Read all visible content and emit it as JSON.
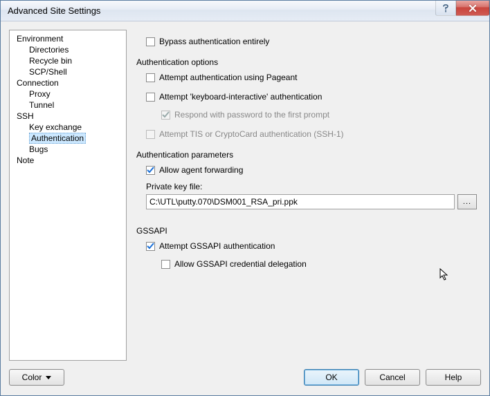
{
  "title": "Advanced Site Settings",
  "tree": {
    "environment": "Environment",
    "directories": "Directories",
    "recycle": "Recycle bin",
    "scp": "SCP/Shell",
    "connection": "Connection",
    "proxy": "Proxy",
    "tunnel": "Tunnel",
    "ssh": "SSH",
    "kex": "Key exchange",
    "auth": "Authentication",
    "bugs": "Bugs",
    "note": "Note"
  },
  "main": {
    "bypass": "Bypass authentication entirely",
    "auth_options_title": "Authentication options",
    "pageant": "Attempt authentication using Pageant",
    "kbi": "Attempt 'keyboard-interactive' authentication",
    "respond": "Respond with password to the first prompt",
    "tis": "Attempt TIS or CryptoCard authentication (SSH-1)",
    "auth_params_title": "Authentication parameters",
    "agent_fwd": "Allow agent forwarding",
    "pk_label": "Private key file:",
    "pk_value": "C:\\UTL\\putty.070\\DSM001_RSA_pri.ppk",
    "browse": "...",
    "gssapi_title": "GSSAPI",
    "gssapi_attempt": "Attempt GSSAPI authentication",
    "gssapi_deleg": "Allow GSSAPI credential delegation"
  },
  "buttons": {
    "color": "Color",
    "ok": "OK",
    "cancel": "Cancel",
    "help": "Help"
  },
  "state": {
    "bypass": false,
    "pageant": false,
    "kbi": false,
    "respond": true,
    "tis": false,
    "agent_fwd": true,
    "gssapi_attempt": true,
    "gssapi_deleg": false
  }
}
